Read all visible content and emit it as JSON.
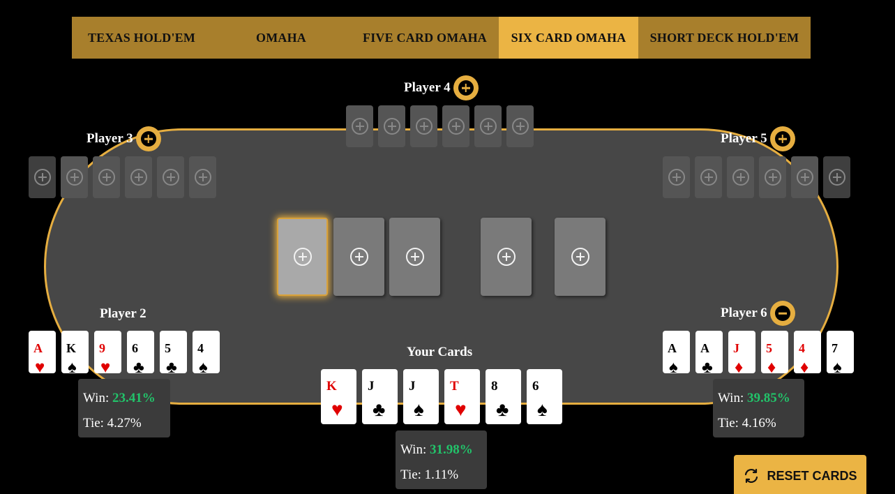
{
  "tabs": [
    {
      "label": "TEXAS HOLD'EM",
      "active": false
    },
    {
      "label": "OMAHA",
      "active": false
    },
    {
      "label": "FIVE CARD OMAHA",
      "active": false
    },
    {
      "label": "SIX CARD OMAHA",
      "active": true
    },
    {
      "label": "SHORT DECK HOLD'EM",
      "active": false
    }
  ],
  "players": {
    "p2": {
      "label": "Player 2",
      "cards": [
        {
          "rank": "A",
          "suit": "♥"
        },
        {
          "rank": "K",
          "suit": "♠"
        },
        {
          "rank": "9",
          "suit": "♥"
        },
        {
          "rank": "6",
          "suit": "♣"
        },
        {
          "rank": "5",
          "suit": "♣"
        },
        {
          "rank": "4",
          "suit": "♠"
        }
      ],
      "win_label": "Win:",
      "win": "23.41%",
      "tie": "Tie: 4.27%"
    },
    "p3": {
      "label": "Player 3",
      "button": "plus-icon"
    },
    "p4": {
      "label": "Player 4",
      "button": "plus-icon"
    },
    "p5": {
      "label": "Player 5",
      "button": "plus-icon"
    },
    "p6": {
      "label": "Player 6",
      "button": "minus-icon",
      "cards": [
        {
          "rank": "A",
          "suit": "♠"
        },
        {
          "rank": "A",
          "suit": "♣"
        },
        {
          "rank": "J",
          "suit": "♦"
        },
        {
          "rank": "5",
          "suit": "♦"
        },
        {
          "rank": "4",
          "suit": "♦"
        },
        {
          "rank": "7",
          "suit": "♠"
        }
      ],
      "win_label": "Win:",
      "win": "39.85%",
      "tie": "Tie: 4.16%"
    }
  },
  "your_cards": {
    "title": "Your Cards",
    "cards": [
      {
        "rank": "K",
        "suit": "♥"
      },
      {
        "rank": "J",
        "suit": "♣"
      },
      {
        "rank": "J",
        "suit": "♠"
      },
      {
        "rank": "T",
        "suit": "♥"
      },
      {
        "rank": "8",
        "suit": "♣"
      },
      {
        "rank": "6",
        "suit": "♠"
      }
    ],
    "win_label": "Win:",
    "win": "31.98%",
    "tie": "Tie: 1.11%"
  },
  "board_icon": "plus-circle-icon",
  "reset": {
    "label": "RESET CARDS",
    "icon": "refresh-icon"
  },
  "colors": {
    "accent": "#ebb444",
    "tab_bar": "#a87f2c",
    "felt": "#474747",
    "win": "#22c36a",
    "red_suit": "#e00000"
  }
}
